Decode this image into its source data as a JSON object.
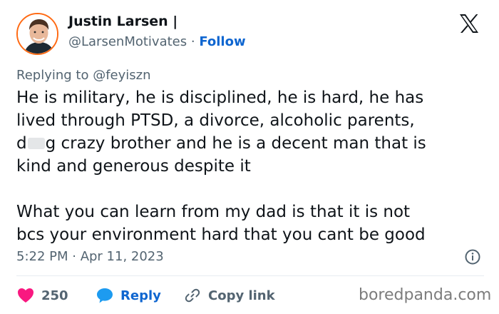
{
  "author": {
    "name": "Justin Larsen |",
    "handle": "@LarsenMotivates",
    "separator": "·",
    "follow_label": "Follow"
  },
  "replying_to": "Replying to @feyiszn",
  "body": {
    "line1": "He is military, he is disciplined, he is hard, he has",
    "line2": "lived through PTSD, a divorce, alcoholic parents,",
    "line3_start": "d",
    "line3_end": "g crazy brother and he is a decent man that is",
    "line4": "kind and generous despite it",
    "line5": "What you can learn from my dad is that it is not",
    "line6": "bcs your environment hard that you cant be good"
  },
  "timestamp": "5:22 PM · Apr 11, 2023",
  "actions": {
    "like_count": "250",
    "reply_label": "Reply",
    "copy_label": "Copy link"
  },
  "watermark": "boredpanda.com",
  "icons": {
    "logo": "x-logo-icon",
    "info": "info-icon",
    "like": "heart-icon",
    "reply": "speech-bubble-icon",
    "copy": "link-icon"
  },
  "colors": {
    "heart": "#f91880",
    "reply": "#1d9bf0",
    "follow": "#0f66d0",
    "secondary_text": "#536471",
    "avatar_ring": "#ff6a13"
  }
}
